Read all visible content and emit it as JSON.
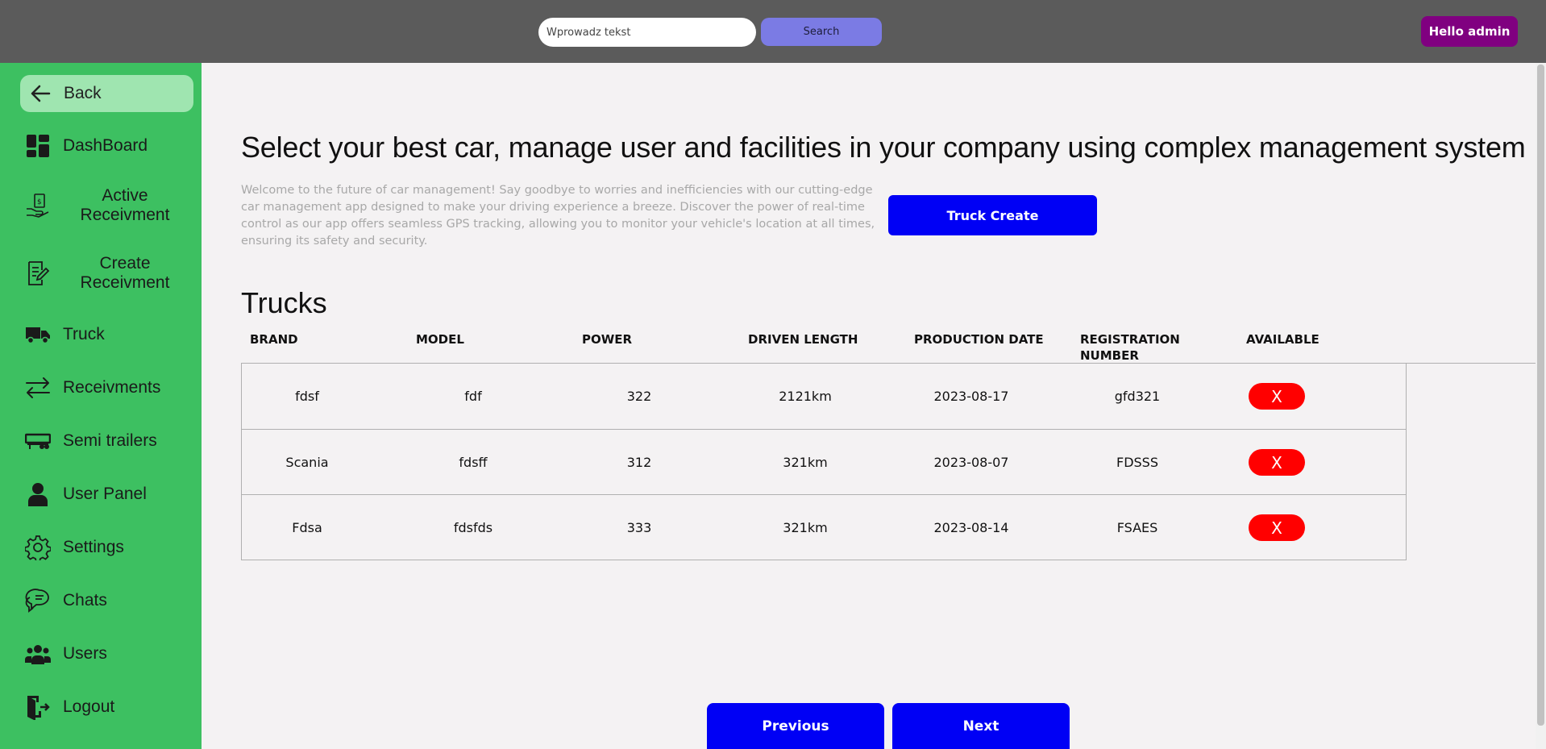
{
  "header": {
    "search_placeholder": "Wprowadz tekst",
    "search_label": "Search",
    "greeting": "Hello admin"
  },
  "sidebar": {
    "back_label": "Back",
    "items": [
      {
        "label": "DashBoard",
        "icon": "dashboard-icon"
      },
      {
        "label": "Active Receivment",
        "icon": "hand-money-icon"
      },
      {
        "label": "Create Receivment",
        "icon": "document-edit-icon"
      },
      {
        "label": "Truck",
        "icon": "truck-icon"
      },
      {
        "label": "Receivments",
        "icon": "arrows-exchange-icon"
      },
      {
        "label": "Semi trailers",
        "icon": "trailer-icon"
      },
      {
        "label": "User Panel",
        "icon": "user-icon"
      },
      {
        "label": "Settings",
        "icon": "gear-icon"
      },
      {
        "label": "Chats",
        "icon": "chat-icon"
      },
      {
        "label": "Users",
        "icon": "users-icon"
      },
      {
        "label": "Logout",
        "icon": "logout-icon"
      }
    ]
  },
  "main": {
    "headline": "Select your best car, manage user and facilities in your company using complex management system",
    "intro": "Welcome to the future of car management! Say goodbye to worries and inefficiencies with our cutting-edge car management app designed to make your driving experience a breeze. Discover the power of real-time control as our app offers seamless GPS tracking, allowing you to monitor your vehicle's location at all times, ensuring its safety and security.",
    "create_label": "Truck Create",
    "section_title": "Trucks",
    "columns": [
      "BRAND",
      "MODEL",
      "POWER",
      "DRIVEN LENGTH",
      "PRODUCTION DATE",
      "REGISTRATION NUMBER",
      "AVAILABLE"
    ],
    "rows": [
      {
        "brand": "fdsf",
        "model": "fdf",
        "power": "322",
        "length": "2121km",
        "date": "2023-08-17",
        "reg": "gfd321",
        "available": "X"
      },
      {
        "brand": "Scania",
        "model": "fdsff",
        "power": "312",
        "length": "321km",
        "date": "2023-08-07",
        "reg": "FDSSS",
        "available": "X"
      },
      {
        "brand": "Fdsa",
        "model": "fdsfds",
        "power": "333",
        "length": "321km",
        "date": "2023-08-14",
        "reg": "FSAES",
        "available": "X"
      }
    ],
    "pager": {
      "previous": "Previous",
      "next": "Next"
    }
  },
  "colors": {
    "topbar": "#5b5b5b",
    "sidebar": "#3dc061",
    "primary_button": "#0000f5",
    "danger": "#ff0000",
    "greeting_bg": "#800080"
  }
}
